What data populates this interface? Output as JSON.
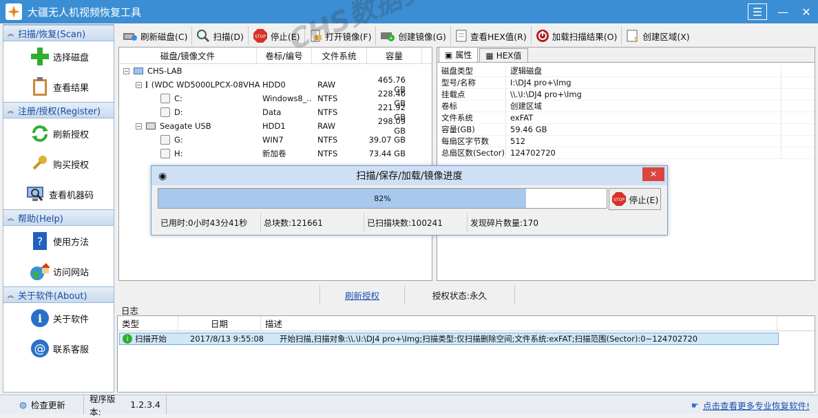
{
  "app": {
    "title": "大疆无人机视频恢复工具",
    "accent": "#3b8ed3"
  },
  "sidebar": {
    "sections": [
      {
        "label": "扫描/恢复(Scan)",
        "items": [
          {
            "label": "选择磁盘",
            "icon": "plus-icon"
          },
          {
            "label": "查看结果",
            "icon": "clipboard-icon"
          }
        ]
      },
      {
        "label": "注册/授权(Register)",
        "items": [
          {
            "label": "刷新授权",
            "icon": "refresh-icon"
          },
          {
            "label": "购买授权",
            "icon": "key-icon"
          },
          {
            "label": "查看机器码",
            "icon": "computer-search-icon"
          }
        ]
      },
      {
        "label": "帮助(Help)",
        "items": [
          {
            "label": "使用方法",
            "icon": "help-book-icon"
          },
          {
            "label": "访问网站",
            "icon": "globe-home-icon"
          }
        ]
      },
      {
        "label": "关于软件(About)",
        "items": [
          {
            "label": "关于软件",
            "icon": "info-icon"
          },
          {
            "label": "联系客服",
            "icon": "at-icon"
          }
        ]
      }
    ]
  },
  "toolbar": {
    "refresh": "刷新磁盘(C)",
    "scan": "扫描(D)",
    "stop": "停止(E)",
    "open_image": "打开镜像(F)",
    "create_image": "创建镜像(G)",
    "view_hex": "查看HEX值(R)",
    "load_scan": "加载扫描结果(O)",
    "create_region": "创建区域(X)"
  },
  "tree": {
    "headers": [
      "磁盘/镜像文件",
      "卷标/编号",
      "文件系统",
      "容量"
    ],
    "rows": [
      {
        "name": "CHS-LAB",
        "label": "",
        "fs": "",
        "size": ""
      },
      {
        "name": "(WDC WD5000LPCX-08VHA",
        "label": "HDD0",
        "fs": "RAW",
        "size": "465.76 GB"
      },
      {
        "name": "C:",
        "label": "Windows8_...",
        "fs": "NTFS",
        "size": "228.46 GB"
      },
      {
        "name": "D:",
        "label": "Data",
        "fs": "NTFS",
        "size": "221.92 GB"
      },
      {
        "name": "Seagate USB",
        "label": "HDD1",
        "fs": "RAW",
        "size": "298.09 GB"
      },
      {
        "name": "G:",
        "label": "WIN7",
        "fs": "NTFS",
        "size": "39.07 GB"
      },
      {
        "name": "H:",
        "label": "新加卷",
        "fs": "NTFS",
        "size": "73.44 GB"
      }
    ]
  },
  "props": {
    "tabs": [
      "属性",
      "HEX值"
    ],
    "rows": [
      {
        "k": "磁盘类型",
        "v": "逻辑磁盘"
      },
      {
        "k": "型号/名称",
        "v": "I:\\DJ4 pro+\\Img"
      },
      {
        "k": "挂载点",
        "v": "\\\\.\\I:\\DJ4 pro+\\Img"
      },
      {
        "k": "卷标",
        "v": "创建区域"
      },
      {
        "k": "文件系统",
        "v": "exFAT"
      },
      {
        "k": "容量(GB)",
        "v": "59.46 GB"
      },
      {
        "k": "每扇区字节数",
        "v": "512"
      },
      {
        "k": "总扇区数(Sector)",
        "v": "124702720"
      }
    ]
  },
  "dialog": {
    "title": "扫描/保存/加载/镜像进度",
    "progress": 0.82,
    "progress_text": "82%",
    "stop": "停止(E)",
    "elapsed": "已用时:0小时43分41秒",
    "total_blocks": "总块数:121661",
    "scanned_blocks": "已扫描块数:100241",
    "fragments": "发现碎片数量:170"
  },
  "midbar": {
    "refresh_link": "刷新授权",
    "auth_status": "授权状态:永久"
  },
  "log": {
    "label": "日志",
    "headers": [
      "类型",
      "日期",
      "描述"
    ],
    "rows": [
      {
        "type": "扫描开始",
        "date": "2017/8/13 9:55:08",
        "desc": "开始扫描,扫描对象:\\\\.\\I:\\DJ4 pro+\\Img;扫描类型:仅扫描删除空间;文件系统:exFAT;扫描范围(Sector):0~124702720"
      }
    ]
  },
  "statusbar": {
    "check_update": "检查更新",
    "version_label": "程序版本:",
    "version": "1.2.3.4",
    "more_link": "点击查看更多专业恢复软件!"
  },
  "watermark": "CHS数据实验室 www.chs.3.com"
}
